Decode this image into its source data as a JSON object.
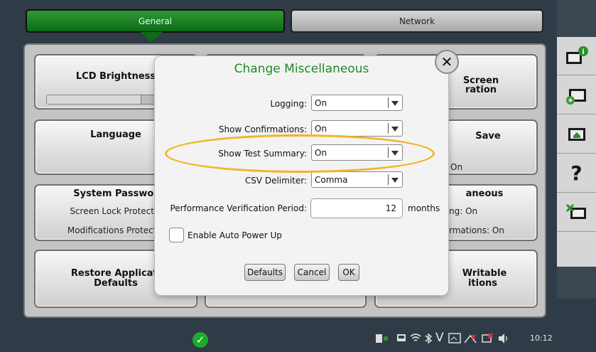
{
  "tabs": {
    "general": "General",
    "network": "Network"
  },
  "tiles": {
    "lcd_brightness": {
      "title": "LCD Brightness"
    },
    "language": {
      "title": "Language"
    },
    "system_password": {
      "title": "System Passwor",
      "line1": "Screen Lock Protectio",
      "line2": "Modifications Protectio"
    },
    "restore_defaults": {
      "title_line1": "Restore Applicati",
      "title_line2": "Defaults"
    },
    "screen_calibration": {
      "title_line1": "Screen",
      "title_line2": "ration"
    },
    "save": {
      "title": "Save",
      "value": "On"
    },
    "miscellaneous": {
      "title": "aneous",
      "line1": "ng: On",
      "line2": "rmations: On"
    },
    "writable": {
      "title_line1": "Writable",
      "title_line2": "itions"
    }
  },
  "dialog": {
    "title": "Change Miscellaneous",
    "logging": {
      "label": "Logging:",
      "value": "On"
    },
    "show_confirmations": {
      "label": "Show Confirmations:",
      "value": "On"
    },
    "show_test_summary": {
      "label": "Show Test Summary:",
      "value": "On"
    },
    "csv_delimiter": {
      "label": "CSV Delimiter:",
      "value": "Comma"
    },
    "perf_verification": {
      "label": "Performance Verification Period:",
      "value": "12",
      "unit": "months"
    },
    "auto_power_up": {
      "label": "Enable Auto Power Up",
      "checked": false
    },
    "buttons": {
      "defaults": "Defaults",
      "cancel": "Cancel",
      "ok": "OK"
    }
  },
  "sidebar": {
    "icons": [
      "info-icon",
      "settings-icon",
      "home-icon",
      "help-icon",
      "tools-icon"
    ],
    "help_glyph": "?"
  },
  "status_bar": {
    "clock": "10:12",
    "tray_letter": "V"
  },
  "colors": {
    "accent_green": "#1f8a24",
    "highlight": "#f2b424",
    "tab_active": "#1a7d25"
  }
}
